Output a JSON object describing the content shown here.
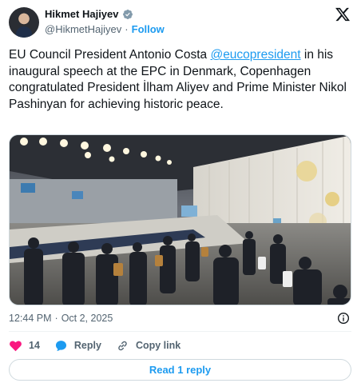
{
  "author": {
    "display_name": "Hikmet Hajiyev",
    "handle": "@HikmetHajiyev",
    "separator": "·",
    "follow_label": "Follow",
    "verified_icon": "verified-badge-icon",
    "avatar": "avatar"
  },
  "tweet": {
    "text_before_mention": "EU Council President Antonio Costa ",
    "mention": "@eucopresident",
    "text_after_mention": " in his inaugural speech at the EPC in Denmark, Copenhagen congratulated President İlham Aliyev and Prime Minister Nikol Pashinyan for achieving historic peace."
  },
  "meta": {
    "time": "12:44 PM",
    "separator": "·",
    "date": "Oct 2, 2025"
  },
  "actions": {
    "like_count": "14",
    "reply_label": "Reply",
    "copy_link_label": "Copy link"
  },
  "read_reply_label": "Read 1 reply",
  "colors": {
    "accent": "#1d9bf0",
    "like": "#f91880",
    "secondary_text": "#536471",
    "border": "#cfd9de"
  }
}
